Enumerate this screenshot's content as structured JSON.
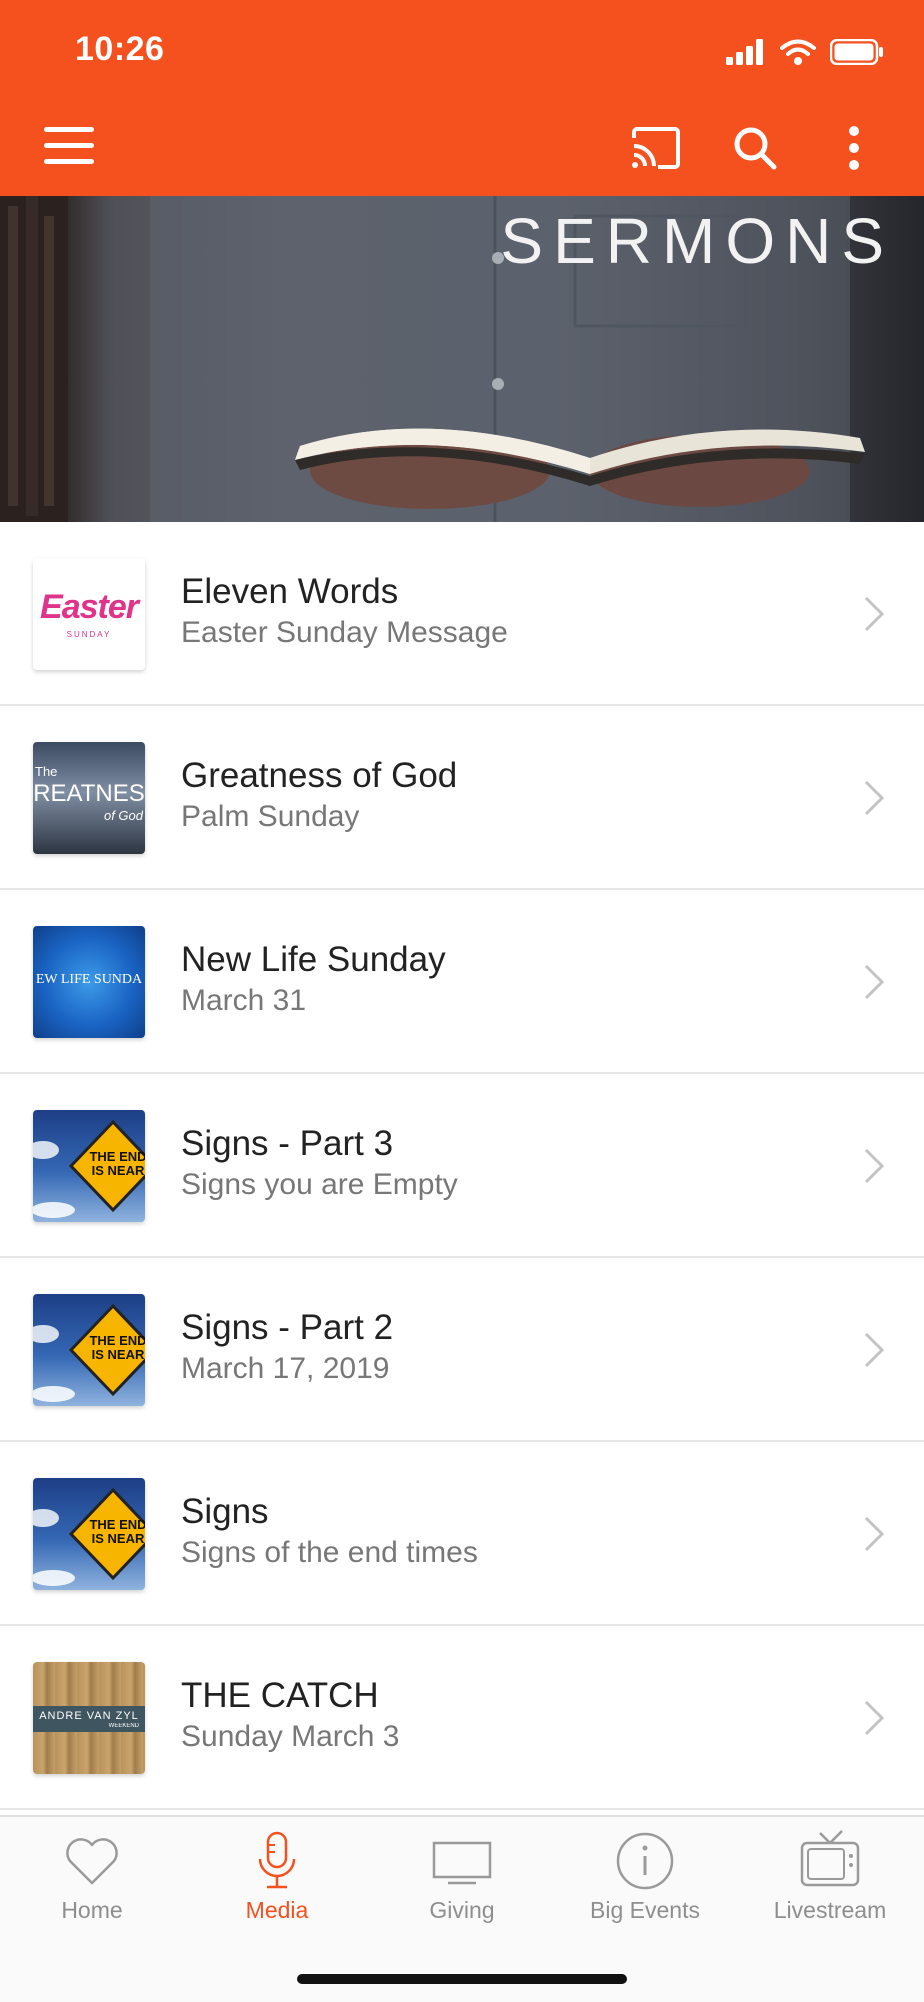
{
  "status_bar": {
    "time": "10:26"
  },
  "toolbar": {
    "menu_icon": "hamburger-menu-icon",
    "cast_icon": "cast-icon",
    "search_icon": "search-icon",
    "more_icon": "more-vertical-icon",
    "color": "#f4511e"
  },
  "hero": {
    "title": "SERMONS"
  },
  "sermons": [
    {
      "title": "Eleven Words",
      "subtitle": "Easter Sunday Message",
      "thumb_text": "Easter",
      "thumb_subtext": "SUNDAY"
    },
    {
      "title": "Greatness of God",
      "subtitle": "Palm Sunday",
      "thumb_text": "REATNES",
      "thumb_pre": "The",
      "thumb_subtext": "of God"
    },
    {
      "title": "New Life Sunday",
      "subtitle": "March 31",
      "thumb_text": "EW LIFE SUNDA"
    },
    {
      "title": "Signs - Part 3",
      "subtitle": "Signs you are Empty",
      "thumb_text": "THE END IS NEAR"
    },
    {
      "title": "Signs - Part 2",
      "subtitle": "March 17, 2019",
      "thumb_text": "THE END IS NEAR"
    },
    {
      "title": "Signs",
      "subtitle": "Signs of the end times",
      "thumb_text": "THE END IS NEAR"
    },
    {
      "title": "THE CATCH",
      "subtitle": "Sunday March 3",
      "thumb_text": "ANDRE VAN ZYL",
      "thumb_subtext": "WEEKEND"
    }
  ],
  "tabs": [
    {
      "label": "Home",
      "icon": "heart-icon",
      "active": false
    },
    {
      "label": "Media",
      "icon": "microphone-icon",
      "active": true
    },
    {
      "label": "Giving",
      "icon": "monitor-icon",
      "active": false
    },
    {
      "label": "Big Events",
      "icon": "info-icon",
      "active": false
    },
    {
      "label": "Livestream",
      "icon": "tv-icon",
      "active": false
    }
  ],
  "colors": {
    "accent": "#f4511e",
    "tab_inactive": "#8e8e8e"
  }
}
